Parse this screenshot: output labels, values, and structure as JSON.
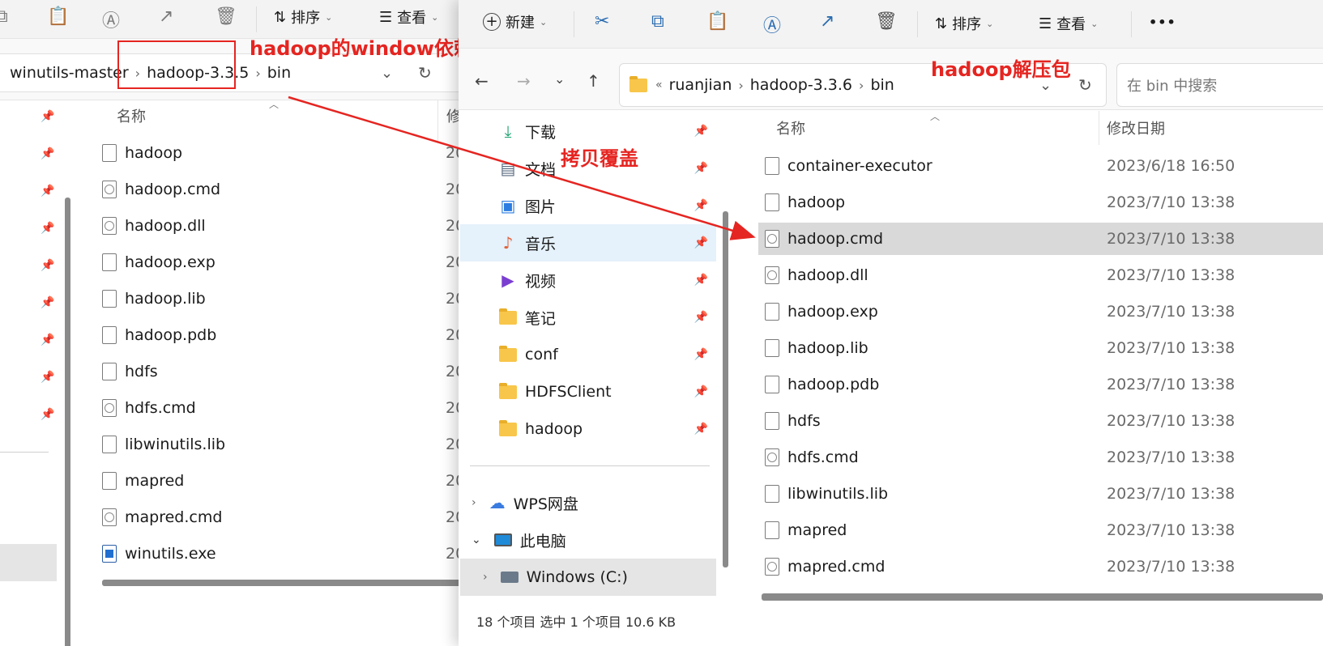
{
  "left_window": {
    "toolbar": {
      "sort_label": "排序",
      "view_label": "查看"
    },
    "breadcrumb": [
      "winutils-master",
      "hadoop-3.3.5",
      "bin"
    ],
    "column_name": "名称",
    "column_modified_partial": "修",
    "files": [
      {
        "name": "hadoop",
        "type": "file",
        "date_partial": "20"
      },
      {
        "name": "hadoop.cmd",
        "type": "cmd",
        "date_partial": "20"
      },
      {
        "name": "hadoop.dll",
        "type": "cmd",
        "date_partial": "20"
      },
      {
        "name": "hadoop.exp",
        "type": "file",
        "date_partial": "20"
      },
      {
        "name": "hadoop.lib",
        "type": "file",
        "date_partial": "20"
      },
      {
        "name": "hadoop.pdb",
        "type": "file",
        "date_partial": "20"
      },
      {
        "name": "hdfs",
        "type": "file",
        "date_partial": "20"
      },
      {
        "name": "hdfs.cmd",
        "type": "cmd",
        "date_partial": "20"
      },
      {
        "name": "libwinutils.lib",
        "type": "file",
        "date_partial": "20"
      },
      {
        "name": "mapred",
        "type": "file",
        "date_partial": "20"
      },
      {
        "name": "mapred.cmd",
        "type": "cmd",
        "date_partial": "20"
      },
      {
        "name": "winutils.exe",
        "type": "exe",
        "date_partial": "20"
      }
    ]
  },
  "right_window": {
    "toolbar": {
      "new_label": "新建",
      "sort_label": "排序",
      "view_label": "查看",
      "more_label": "•••"
    },
    "breadcrumb": [
      "ruanjian",
      "hadoop-3.3.6",
      "bin"
    ],
    "breadcrumb_prefix": "«",
    "search_placeholder": "在 bin 中搜索",
    "column_name": "名称",
    "column_modified": "修改日期",
    "nav_items": [
      {
        "label": "下载",
        "icon": "download-icon"
      },
      {
        "label": "文档",
        "icon": "document-icon"
      },
      {
        "label": "图片",
        "icon": "picture-icon"
      },
      {
        "label": "音乐",
        "icon": "music-icon"
      },
      {
        "label": "视频",
        "icon": "video-icon"
      },
      {
        "label": "笔记",
        "icon": "folder-icon"
      },
      {
        "label": "conf",
        "icon": "folder-icon"
      },
      {
        "label": "HDFSClient",
        "icon": "folder-icon"
      },
      {
        "label": "hadoop",
        "icon": "folder-icon"
      }
    ],
    "wps_label": "WPS网盘",
    "this_pc_label": "此电脑",
    "drive_label": "Windows  (C:)",
    "status_bar": "18 个项目    选中 1 个项目  10.6 KB",
    "files": [
      {
        "name": "container-executor",
        "type": "file",
        "date": "2023/6/18 16:50"
      },
      {
        "name": "hadoop",
        "type": "file",
        "date": "2023/7/10 13:38"
      },
      {
        "name": "hadoop.cmd",
        "type": "cmd",
        "date": "2023/7/10 13:38"
      },
      {
        "name": "hadoop.dll",
        "type": "cmd",
        "date": "2023/7/10 13:38"
      },
      {
        "name": "hadoop.exp",
        "type": "file",
        "date": "2023/7/10 13:38"
      },
      {
        "name": "hadoop.lib",
        "type": "file",
        "date": "2023/7/10 13:38"
      },
      {
        "name": "hadoop.pdb",
        "type": "file",
        "date": "2023/7/10 13:38"
      },
      {
        "name": "hdfs",
        "type": "file",
        "date": "2023/7/10 13:38"
      },
      {
        "name": "hdfs.cmd",
        "type": "cmd",
        "date": "2023/7/10 13:38"
      },
      {
        "name": "libwinutils.lib",
        "type": "file",
        "date": "2023/7/10 13:38"
      },
      {
        "name": "mapred",
        "type": "file",
        "date": "2023/7/10 13:38"
      },
      {
        "name": "mapred.cmd",
        "type": "cmd",
        "date": "2023/7/10 13:38"
      }
    ]
  },
  "annotations": {
    "left_label": "hadoop的window依赖包",
    "right_label": "hadoop解压包",
    "arrow_label": "拷贝覆盖",
    "color": "#e52521"
  },
  "colors": {
    "selection": "#d9d9d9",
    "nav_selection": "#e5f1fb",
    "folder": "#f8c64a"
  }
}
